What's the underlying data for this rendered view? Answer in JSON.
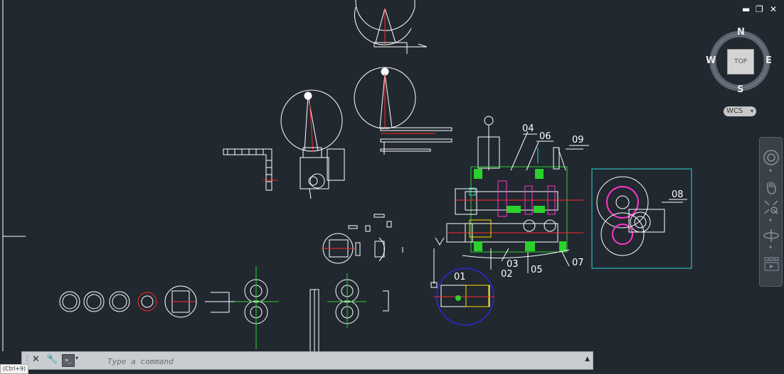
{
  "window_controls": {
    "minimize": "▬",
    "restore": "❐",
    "close": "✕"
  },
  "viewcube": {
    "north": "N",
    "south": "S",
    "east": "E",
    "west": "W",
    "face": "TOP"
  },
  "wcs": {
    "label": "WCS"
  },
  "part_labels": [
    "04",
    "06",
    "09",
    "08",
    "01",
    "02",
    "03",
    "05",
    "07"
  ],
  "command_line": {
    "placeholder": "Type a command",
    "prompt_icon": ">_"
  },
  "tooltip": {
    "text": "(Ctrl+9)"
  },
  "colors": {
    "background": "#212830",
    "linework": "#ffffff",
    "red": "#ff2a2a",
    "green": "#2bd22b",
    "magenta": "#ff33cc",
    "cyan": "#2fd6d6",
    "blue": "#2b2bd8",
    "yellow": "#ffd800"
  }
}
